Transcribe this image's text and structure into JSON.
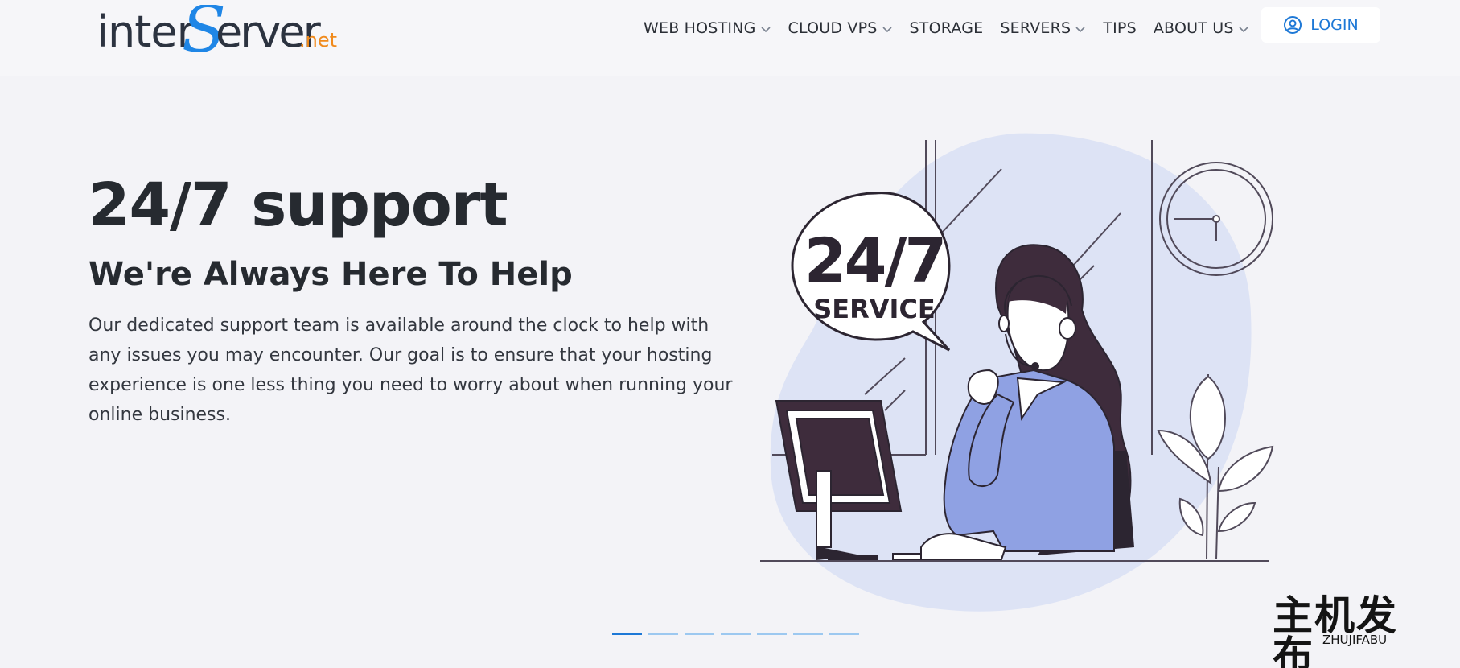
{
  "brand": {
    "logo_inter": "inter",
    "logo_s": "S",
    "logo_erver": "erver",
    "logo_net": ".net",
    "colors": {
      "accent": "#1d78d6",
      "logo_s": "#1f86e6",
      "logo_net": "#f08a1c"
    }
  },
  "nav": {
    "items": [
      {
        "label": "WEB HOSTING",
        "has_dropdown": true
      },
      {
        "label": "CLOUD VPS",
        "has_dropdown": true
      },
      {
        "label": "STORAGE",
        "has_dropdown": false
      },
      {
        "label": "SERVERS",
        "has_dropdown": true
      },
      {
        "label": "TIPS",
        "has_dropdown": false
      },
      {
        "label": "ABOUT US",
        "has_dropdown": true
      }
    ],
    "login_label": "LOGIN",
    "login_icon": "user-circle-icon"
  },
  "hero": {
    "title": "24/7 support",
    "subtitle": "We're Always Here To Help",
    "body_lines": [
      "Our dedicated support team is available around the clock to help with",
      "any issues you may encounter. Our goal is to ensure that your hosting",
      "experience is one less thing you need to worry about when running your",
      "online business."
    ]
  },
  "illustration": {
    "bubble_big": "24/7",
    "bubble_small": "SERVICE"
  },
  "carousel": {
    "slide_count": 7,
    "active_index": 0
  },
  "watermark": {
    "cn": "主机发布",
    "en": "ZHUJIFABU"
  }
}
